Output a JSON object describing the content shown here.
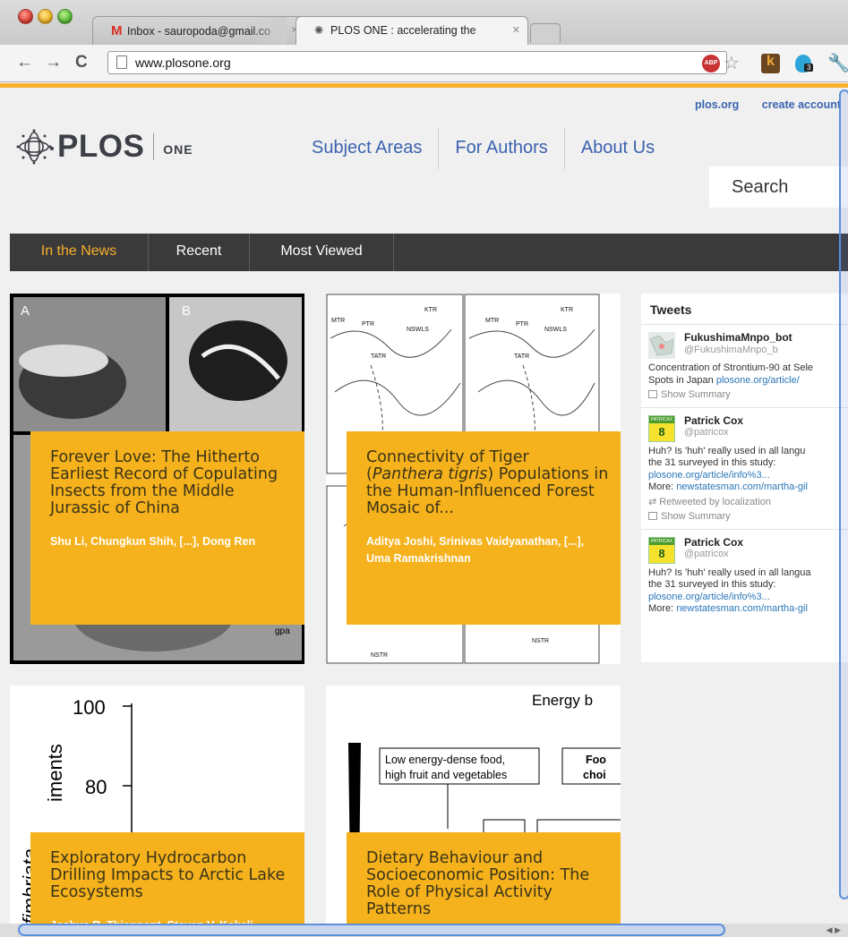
{
  "browser": {
    "tabs": [
      {
        "title": "Inbox - sauropoda@gmail.co",
        "favicon": "gmail-icon"
      },
      {
        "title": "PLOS ONE : accelerating the",
        "favicon": "plos-icon"
      }
    ],
    "url": "www.plosone.org",
    "toolbar_icons": [
      "back-icon",
      "forward-icon",
      "reload-icon",
      "page-icon",
      "adblock-icon",
      "star-icon",
      "k-extension-icon",
      "extension-icon",
      "wrench-icon"
    ],
    "extension_badge": "3",
    "abp_label": "ABP"
  },
  "site": {
    "top_links": [
      "plos.org",
      "create account"
    ],
    "logo": {
      "brand": "PLOS",
      "product": "ONE"
    },
    "nav": [
      "Subject Areas",
      "For Authors",
      "About Us"
    ],
    "search_placeholder": "Search",
    "tabs": [
      "In the News",
      "Recent",
      "Most Viewed"
    ],
    "active_tab": "In the News",
    "accent": "#f8af2d",
    "card_color": "#f5b21c",
    "link_color": "#3c63af"
  },
  "articles": [
    {
      "title": "Forever Love: The Hitherto Earliest Record of Copulating Insects from the Middle Jurassic of China",
      "authors": "Shu Li, Chungkun Shih, [...], Dong Ren",
      "image_labels": [
        "A",
        "B",
        "gpa"
      ]
    },
    {
      "title_pre": "Connectivity of Tiger (",
      "title_em": "Panthera tigris",
      "title_post": ") Populations in the Human-Influenced Forest Mosaic of...",
      "authors": "Aditya Joshi, Srinivas Vaidyanathan, [...], Uma Ramakrishnan",
      "image_labels": [
        "MTR",
        "PTR",
        "KTR",
        "NSWLS",
        "TATR",
        "MTR",
        "PTR",
        "KTR",
        "NSWLS",
        "TATR",
        "NSTR",
        "NSTR"
      ]
    },
    {
      "title": "Exploratory Hydrocarbon Drilling Impacts to Arctic Lake Ecosystems",
      "authors": "Joshua R. Thienpont, Steven V. Kokelj",
      "image_labels": [
        "100",
        "80",
        "iments",
        "mfimbriata"
      ]
    },
    {
      "title": "Dietary Behaviour and Socioeconomic Position: The Role of Physical Activity Patterns",
      "authors": "",
      "image_labels": [
        "Energy b",
        "Low energy-dense food,",
        "high fruit and vegetables",
        "Foo",
        "choi"
      ]
    }
  ],
  "tweets": {
    "heading": "Tweets",
    "items": [
      {
        "name": "FukushimaMnpo_bot",
        "handle": "@FukushimaMnpo_b",
        "lines": [
          "Concentration of Strontium-90 at Sele",
          "Spots in Japan "
        ],
        "link": "plosone.org/article/",
        "actions": [
          "Show Summary"
        ]
      },
      {
        "name": "Patrick Cox",
        "handle": "@patricox",
        "lines": [
          "Huh? Is 'huh' really used in all langu",
          "the 31 surveyed in this study:"
        ],
        "link": "plosone.org/article/info%3...",
        "more_label": "More: ",
        "more_link": "newstatesman.com/martha-gil",
        "retweet": "Retweeted by localization",
        "actions": [
          "Show Summary"
        ],
        "avatar_top": "PATRICAX",
        "avatar_num": "8"
      },
      {
        "name": "Patrick Cox",
        "handle": "@patricox",
        "lines": [
          "Huh? Is 'huh' really used in all langua",
          "the 31 surveyed in this study:"
        ],
        "link": "plosone.org/article/info%3...",
        "more_label": "More: ",
        "more_link": "newstatesman.com/martha-gil",
        "avatar_top": "PATRICAX",
        "avatar_num": "8"
      }
    ]
  }
}
